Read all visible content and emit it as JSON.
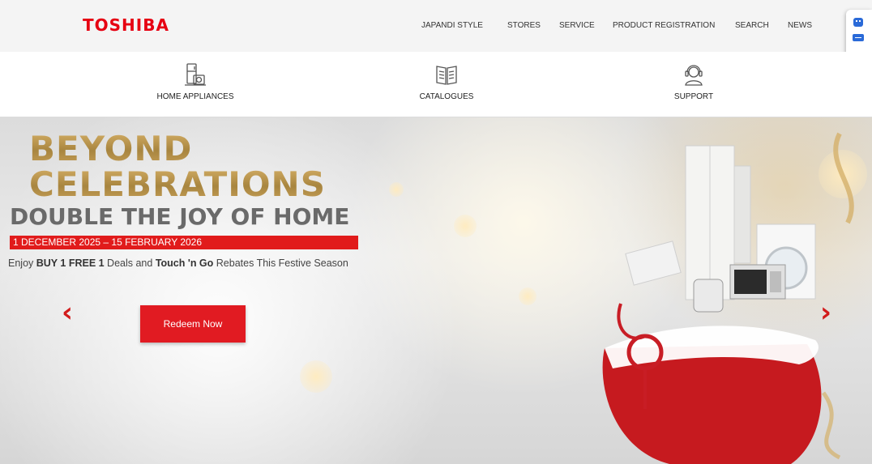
{
  "header": {
    "logo": "TOSHIBA",
    "nav": [
      "JAPANDI STYLE",
      "STORES",
      "SERVICE",
      "PRODUCT REGISTRATION",
      "SEARCH",
      "NEWS"
    ]
  },
  "categories": [
    {
      "label": "HOME APPLIANCES",
      "icon": "appliances-icon"
    },
    {
      "label": "CATALOGUES",
      "icon": "catalogue-book-icon"
    },
    {
      "label": "SUPPORT",
      "icon": "support-headset-icon"
    }
  ],
  "hero": {
    "line1": "BEYOND",
    "line2": "CELEBRATIONS",
    "line3": "DOUBLE THE JOY OF HOME",
    "date_range": "1 DECEMBER 2025 – 15 FEBRUARY 2026",
    "desc_part1": "Enjoy ",
    "desc_bold1": "BUY 1 FREE 1",
    "desc_part2": " Deals and ",
    "desc_bold2": "Touch 'n Go",
    "desc_part3": " Rebates This Festive Season",
    "cta": "Redeem Now",
    "prev_glyph": "‹",
    "next_glyph": "›"
  },
  "colors": {
    "brand_red": "#e60012",
    "gold": "#b8924a",
    "button_red": "#e11b22"
  }
}
